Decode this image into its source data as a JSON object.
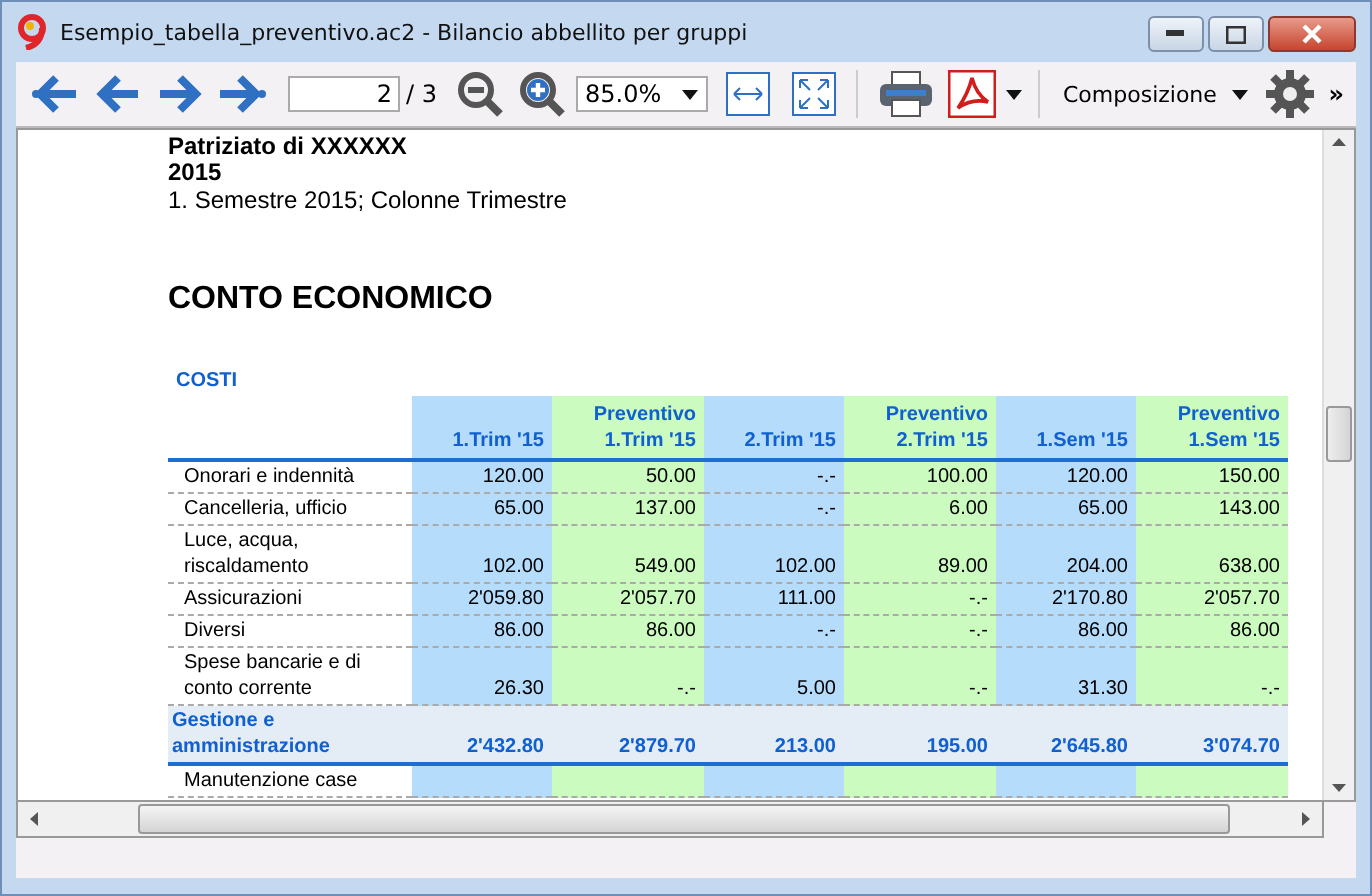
{
  "window": {
    "title": "Esempio_tabella_preventivo.ac2 - Bilancio abbellito per gruppi"
  },
  "toolbar": {
    "page": "2",
    "page_total": "/ 3",
    "zoom": "85.0%",
    "layout_menu": "Composizione",
    "more": "»"
  },
  "document": {
    "org": "Patriziato di XXXXXX",
    "year": "2015",
    "period": "1. Semestre 2015; Colonne Trimestre",
    "heading": "CONTO ECONOMICO",
    "section": "COSTI",
    "columns": [
      {
        "label": "1.Trim '15",
        "kind": "actual"
      },
      {
        "label": "Preventivo 1.Trim '15",
        "kind": "budget"
      },
      {
        "label": "2.Trim '15",
        "kind": "actual"
      },
      {
        "label": "Preventivo 2.Trim '15",
        "kind": "budget"
      },
      {
        "label": "1.Sem '15",
        "kind": "actual"
      },
      {
        "label": "Preventivo 1.Sem '15",
        "kind": "budget"
      }
    ],
    "rows": [
      {
        "kind": "item",
        "label": "Onorari e indennità",
        "values": [
          "120.00",
          "50.00",
          "-.-",
          "100.00",
          "120.00",
          "150.00"
        ]
      },
      {
        "kind": "item",
        "label": "Cancelleria, ufficio",
        "values": [
          "65.00",
          "137.00",
          "-.-",
          "6.00",
          "65.00",
          "143.00"
        ]
      },
      {
        "kind": "item",
        "label": "Luce, acqua, riscaldamento",
        "values": [
          "102.00",
          "549.00",
          "102.00",
          "89.00",
          "204.00",
          "638.00"
        ]
      },
      {
        "kind": "item",
        "label": "Assicurazioni",
        "values": [
          "2'059.80",
          "2'057.70",
          "111.00",
          "-.-",
          "2'170.80",
          "2'057.70"
        ]
      },
      {
        "kind": "item",
        "label": "Diversi",
        "values": [
          "86.00",
          "86.00",
          "-.-",
          "-.-",
          "86.00",
          "86.00"
        ]
      },
      {
        "kind": "item",
        "label": "Spese bancarie e di conto corrente",
        "values": [
          "26.30",
          "-.-",
          "5.00",
          "-.-",
          "31.30",
          "-.-"
        ]
      },
      {
        "kind": "total",
        "label": "Gestione e amministrazione",
        "values": [
          "2'432.80",
          "2'879.70",
          "213.00",
          "195.00",
          "2'645.80",
          "3'074.70"
        ]
      },
      {
        "kind": "item",
        "label": "Manutenzione case",
        "values": []
      }
    ]
  }
}
